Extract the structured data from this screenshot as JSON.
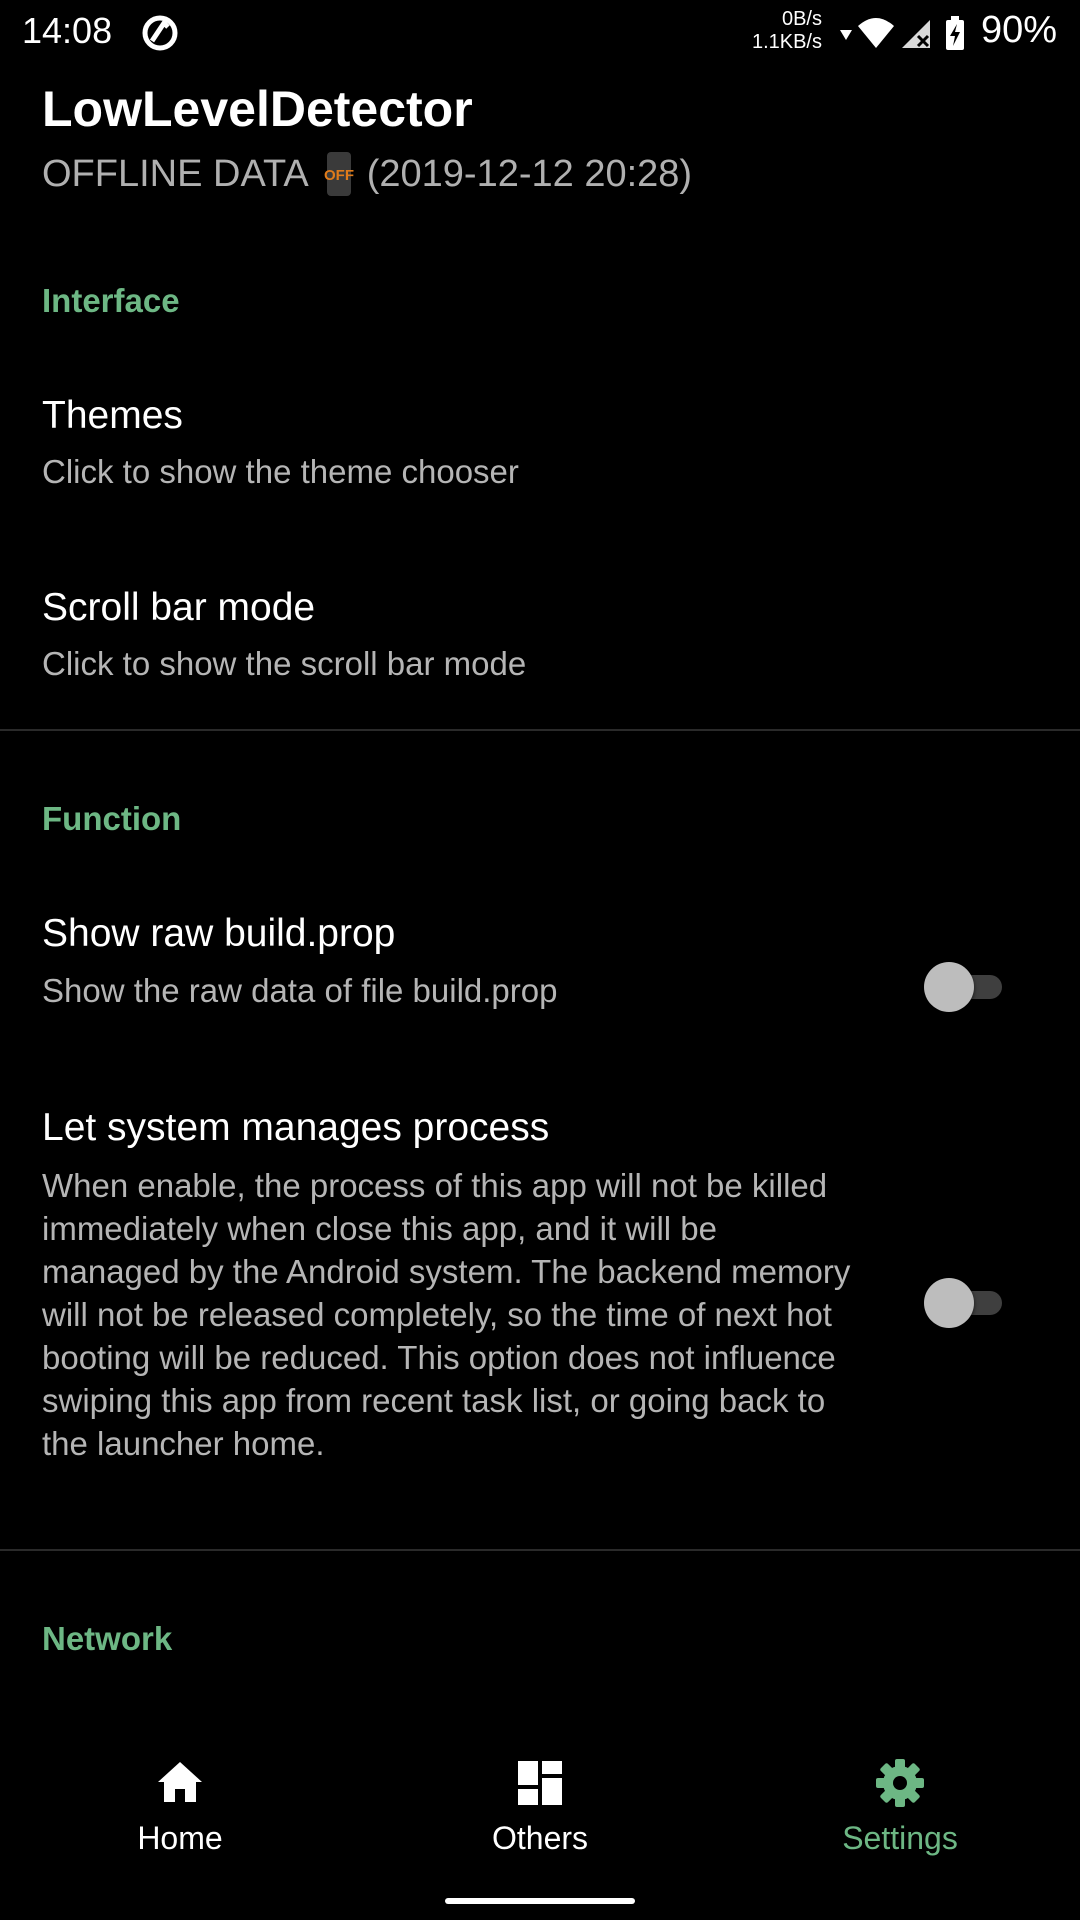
{
  "status_bar": {
    "time": "14:08",
    "upload_speed": "0B/s",
    "download_speed": "1.1KB/s",
    "battery_percent": "90%"
  },
  "header": {
    "title": "LowLevelDetector",
    "subtitle_prefix": "OFFLINE DATA",
    "badge_text": "OFF",
    "subtitle_timestamp": "(2019-12-12 20:28)"
  },
  "sections": {
    "interface": {
      "label": "Interface",
      "themes": {
        "title": "Themes",
        "summary": "Click to show the theme chooser"
      },
      "scroll_bar_mode": {
        "title": "Scroll bar mode",
        "summary": "Click to show the scroll bar mode"
      }
    },
    "function": {
      "label": "Function",
      "show_raw_build_prop": {
        "title": "Show raw build.prop",
        "summary": "Show the raw data of file build.prop",
        "enabled": false
      },
      "let_system_manage": {
        "title": "Let system manages process",
        "summary": "When enable, the process of this app will not be killed immediately when close this app, and it will be managed by the Android system. The backend memory will not be released completely, so the time of next hot booting will be reduced. This option does not influence swiping this app from recent task list, or going back to the launcher home.",
        "enabled": false
      }
    },
    "network": {
      "label": "Network"
    }
  },
  "bottom_nav": {
    "items": [
      {
        "label": "Home",
        "icon": "home-icon",
        "active": false
      },
      {
        "label": "Others",
        "icon": "dashboard-icon",
        "active": false
      },
      {
        "label": "Settings",
        "icon": "gear-icon",
        "active": true
      }
    ]
  },
  "colors": {
    "accent": "#6db784",
    "background": "#000000",
    "badge": "#e07b1a"
  }
}
